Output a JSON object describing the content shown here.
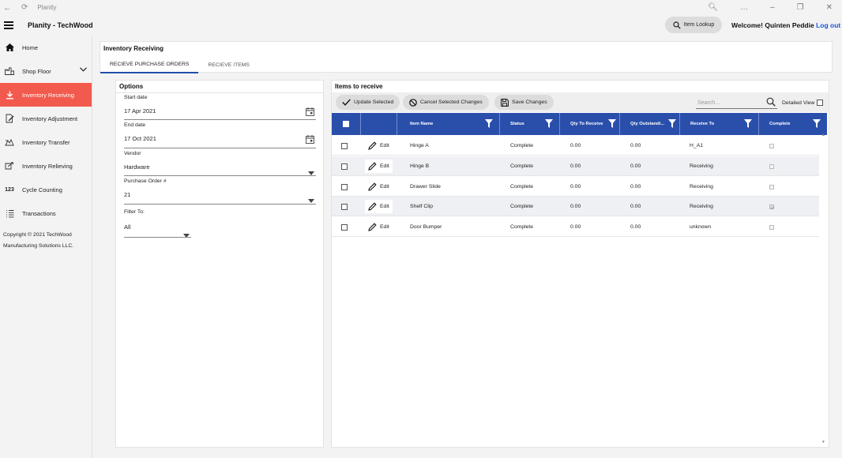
{
  "window": {
    "title": "Planity",
    "controls": [
      "…",
      "–",
      "❐",
      "✕"
    ]
  },
  "appbar": {
    "title": "Planity - TechWood",
    "item_lookup_label": "Item Lookup",
    "welcome_text": "Welcome! Quinten Peddie",
    "logout_label": "Log out"
  },
  "sidebar": {
    "items": [
      {
        "label": "Home",
        "icon": "home-icon"
      },
      {
        "label": "Shop Floor",
        "icon": "factory-icon"
      },
      {
        "label": "Inventory Receiving",
        "icon": "download-icon",
        "active": true
      },
      {
        "label": "Inventory Adjustment",
        "icon": "edit-doc-icon"
      },
      {
        "label": "Inventory Transfer",
        "icon": "transfer-icon"
      },
      {
        "label": "Inventory Relieving",
        "icon": "relieve-icon"
      },
      {
        "label": "Cycle Counting",
        "icon": "123"
      },
      {
        "label": "Transactions",
        "icon": "list-icon"
      }
    ],
    "copyright_line1": "Copyright © 2021 TechWood",
    "copyright_line2": "Manufacturing Solutions LLC."
  },
  "page": {
    "title": "Inventory Receiving",
    "tabs": [
      {
        "label": "RECIEVE PURCHASE ORDERS",
        "active": true
      },
      {
        "label": "RECIEVE ITEMS",
        "active": false
      }
    ]
  },
  "options": {
    "title": "Options",
    "start_date_label": "Start date",
    "start_date_value": "17 Apr 2021",
    "end_date_label": "End date",
    "end_date_value": "17 Oct 2021",
    "vendor_label": "Vendor",
    "vendor_value": "Hardware",
    "po_label": "Purchase Order #",
    "po_value": "21",
    "filter_label": "Filter To:",
    "filter_value": "All"
  },
  "items": {
    "title": "Items to receive",
    "update_selected_label": "Update Selected",
    "cancel_changes_label": "Cancel Selected Changes",
    "save_changes_label": "Save Changes",
    "search_placeholder": "Search...",
    "detailed_view_label": "Detailed View",
    "columns": [
      "Item Name",
      "Status",
      "Qty To Receive",
      "Qty Outstandi...",
      "Receive To",
      "Complete"
    ],
    "edit_label": "Edit",
    "rows": [
      {
        "name": "Hinge A",
        "status": "Complete",
        "qty_to_receive": "0.00",
        "qty_outstanding": "0.00",
        "receive_to": "H_A1",
        "complete": false
      },
      {
        "name": "Hinge B",
        "status": "Complete",
        "qty_to_receive": "0.00",
        "qty_outstanding": "0.00",
        "receive_to": "Receiving",
        "complete": false
      },
      {
        "name": "Drawer Slide",
        "status": "Complete",
        "qty_to_receive": "0.00",
        "qty_outstanding": "0.00",
        "receive_to": "Receiving",
        "complete": false
      },
      {
        "name": "Shelf Clip",
        "status": "Complete",
        "qty_to_receive": "0.00",
        "qty_outstanding": "0.00",
        "receive_to": "Receiving",
        "complete": true
      },
      {
        "name": "Door Bumper",
        "status": "Complete",
        "qty_to_receive": "0.00",
        "qty_outstanding": "0.00",
        "receive_to": "unknown",
        "complete": false
      }
    ]
  },
  "colors": {
    "accent": "#f25a4d",
    "grid_header": "#2a4fab",
    "link": "#1a56db"
  }
}
